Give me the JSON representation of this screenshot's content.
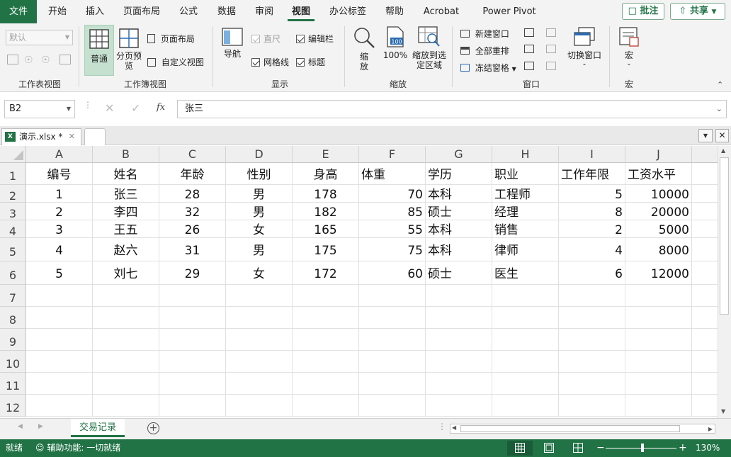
{
  "ribbon_tabs": [
    "文件",
    "开始",
    "插入",
    "页面布局",
    "公式",
    "数据",
    "审阅",
    "视图",
    "办公标签",
    "帮助",
    "Acrobat",
    "Power Pivot"
  ],
  "active_tab": "视图",
  "top_buttons": {
    "comments": "批注",
    "share": "共享"
  },
  "ribbon": {
    "sheet_view": {
      "select_value": "默认",
      "label": "工作表视图"
    },
    "workbook_views": {
      "normal": "普通",
      "page_break": "分页预览",
      "page_layout": "页面布局",
      "custom_views": "自定义视图",
      "label": "工作簿视图"
    },
    "show": {
      "navigation": "导航",
      "ruler": "直尺",
      "gridlines": "网格线",
      "formula_bar": "编辑栏",
      "headings": "标题",
      "label": "显示"
    },
    "zoom": {
      "zoom": "缩放",
      "hundred": "100%",
      "zoom_to_selection": "缩放到选定区域",
      "label": "缩放"
    },
    "window": {
      "new_window": "新建窗口",
      "arrange_all": "全部重排",
      "freeze_panes": "冻结窗格",
      "switch_windows": "切换窗口",
      "label": "窗口"
    },
    "macros": {
      "macros": "宏",
      "label": "宏"
    }
  },
  "formula_bar": {
    "name_box": "B2",
    "fx": "fx",
    "value": "张三"
  },
  "workbook_tab": {
    "name": "演示.xlsx *"
  },
  "columns": [
    "A",
    "B",
    "C",
    "D",
    "E",
    "F",
    "G",
    "H",
    "I",
    "J"
  ],
  "rows": [
    "1",
    "2",
    "3",
    "4",
    "5",
    "6",
    "7",
    "8",
    "9",
    "10",
    "11",
    "12"
  ],
  "table": {
    "header": [
      "编号",
      "姓名",
      "年龄",
      "性别",
      "身高",
      "体重",
      "学历",
      "职业",
      "工作年限",
      "工资水平"
    ],
    "data": [
      [
        "1",
        "张三",
        "28",
        "男",
        "178",
        "70",
        "本科",
        "工程师",
        "5",
        "10000"
      ],
      [
        "2",
        "李四",
        "32",
        "男",
        "182",
        "85",
        "硕士",
        "经理",
        "8",
        "20000"
      ],
      [
        "3",
        "王五",
        "26",
        "女",
        "165",
        "55",
        "本科",
        "销售",
        "2",
        "5000"
      ],
      [
        "4",
        "赵六",
        "31",
        "男",
        "175",
        "75",
        "本科",
        "律师",
        "4",
        "8000"
      ],
      [
        "5",
        "刘七",
        "29",
        "女",
        "172",
        "60",
        "硕士",
        "医生",
        "6",
        "12000"
      ]
    ]
  },
  "sheet_tabs": [
    "交易记录"
  ],
  "status": {
    "ready": "就绪",
    "accessibility": "辅助功能: 一切就绪",
    "zoom": "130%"
  },
  "colors": {
    "accent": "#217346",
    "selected_view": "#c5e0cf"
  }
}
